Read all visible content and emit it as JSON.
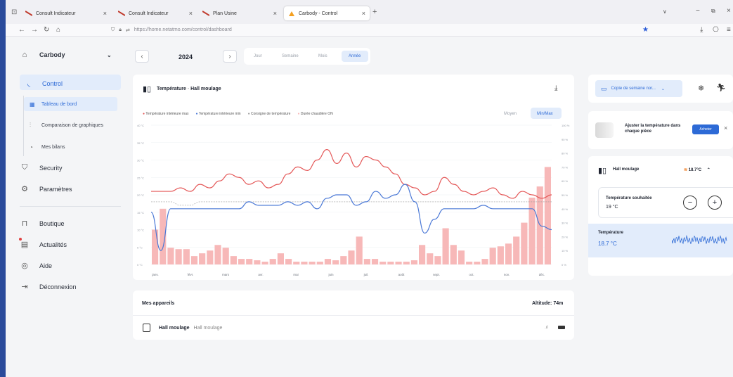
{
  "browser": {
    "tabs": [
      {
        "label": "Consult Indicateur"
      },
      {
        "label": "Consult Indicateur"
      },
      {
        "label": "Plan Usine"
      },
      {
        "label": "Carbody - Control"
      }
    ],
    "url": "https://home.netatmo.com/control/dashboard"
  },
  "sidebar": {
    "home": "Carbody",
    "control": "Control",
    "sub": [
      "Tableau de bord",
      "Comparaison de graphiques",
      "Mes bilans"
    ],
    "items": [
      "Security",
      "Paramètres"
    ],
    "items2": [
      "Boutique",
      "Actualités",
      "Aide",
      "Déconnexion"
    ]
  },
  "period": {
    "year": "2024",
    "options": [
      "Jour",
      "Semaine",
      "Mois",
      "Année"
    ]
  },
  "chart_card": {
    "title": "Température",
    "room": "Hall moulage",
    "legend": [
      "Température intérieure max",
      "Température intérieure min",
      "Consigne de température",
      "Durée chaudière ON"
    ],
    "mode_options": [
      "Moyen",
      "Min/Max"
    ]
  },
  "chart_data": {
    "type": "line",
    "categories": [
      "janv.",
      "févr.",
      "mars",
      "avr.",
      "mai",
      "juin",
      "juil.",
      "août",
      "sept.",
      "oct.",
      "nov.",
      "déc."
    ],
    "y_left_ticks": [
      "40 °C",
      "35 °C",
      "30 °C",
      "25 °C",
      "20 °C",
      "15 °C",
      "10 °C",
      "5 °C",
      "0 °C"
    ],
    "y_right_ticks": [
      "100 %",
      "90 %",
      "80 %",
      "70 %",
      "60 %",
      "50 %",
      "40 %",
      "30 %",
      "20 %",
      "10 %",
      "0 %"
    ],
    "ylim_left": [
      0,
      40
    ],
    "ylim_right": [
      0,
      100
    ],
    "series": [
      {
        "name": "Température intérieure max",
        "color": "#e45757",
        "values": [
          21,
          21,
          21,
          22,
          21,
          23,
          22,
          24,
          26,
          25,
          23,
          24,
          22,
          23,
          26,
          28,
          27,
          30,
          33,
          29,
          32,
          28,
          31,
          30,
          28,
          26,
          23,
          22,
          20,
          21,
          25,
          23,
          21,
          20,
          21,
          22,
          20,
          19,
          21,
          20,
          19,
          20
        ]
      },
      {
        "name": "Température intérieure min",
        "color": "#4a78d6",
        "values": [
          15,
          4,
          16,
          16,
          16,
          16,
          16,
          16,
          16,
          16,
          18,
          17,
          17,
          17,
          18,
          17,
          18,
          16,
          19,
          20,
          20,
          17,
          18,
          21,
          19,
          20,
          23,
          18,
          9,
          13,
          16,
          16,
          16,
          16,
          17,
          16,
          16,
          16,
          16,
          16,
          11,
          10
        ]
      },
      {
        "name": "Consigne de température",
        "color": "#9a9a9a",
        "values": [
          18,
          18,
          18,
          17,
          17,
          18,
          18,
          18,
          18,
          18,
          18,
          18,
          18,
          18,
          18,
          18,
          18,
          18,
          18,
          18,
          18,
          18,
          18,
          18,
          18,
          18,
          18,
          18,
          18,
          18,
          18,
          18,
          18,
          18,
          18,
          18,
          18,
          18,
          18,
          18,
          18,
          18
        ]
      },
      {
        "name": "Durée chaudière ON",
        "color": "#f7b8b8",
        "values": [
          25,
          40,
          12,
          11,
          11,
          6,
          8,
          10,
          14,
          12,
          6,
          4,
          4,
          3,
          2,
          4,
          8,
          4,
          2,
          2,
          2,
          2,
          4,
          3,
          6,
          10,
          20,
          4,
          4,
          2,
          2,
          2,
          2,
          3,
          14,
          8,
          6,
          26,
          14,
          10,
          2,
          2,
          4,
          12,
          13,
          15,
          20,
          30,
          48,
          56,
          70
        ]
      }
    ]
  },
  "devices": {
    "title": "Mes appareils",
    "altitude": "Altitude: 74m",
    "item_name": "Hall moulage",
    "item_room": "Hall moulage"
  },
  "right_panel": {
    "schedule": "Copie de semaine nor...",
    "promo_text": "Ajuster la température dans chaque pièce",
    "promo_button": "Acheter",
    "room_title": "Hall moulage",
    "room_temp": "18.7°C",
    "setpoint_label": "Température souhaitée",
    "setpoint_value": "19 °C",
    "temp_label": "Température",
    "temp_value": "18.7 °C"
  },
  "colors": {
    "accent": "#2d6ad6",
    "max": "#e45757",
    "min": "#4a78d6",
    "bars": "#f7b8b8",
    "heat": "#f07a1d"
  }
}
